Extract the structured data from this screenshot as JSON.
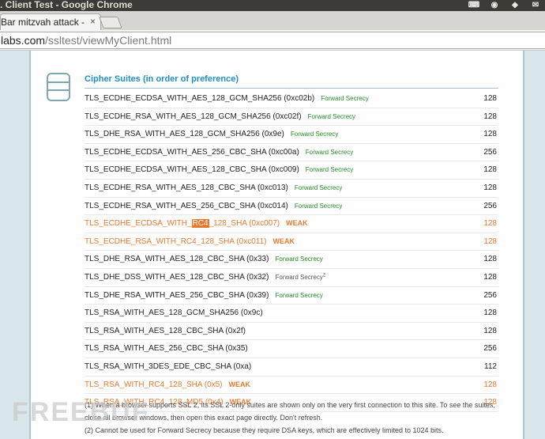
{
  "window": {
    "title": ". Client Test - Google Chrome"
  },
  "tray": {
    "icons": [
      "keyboard-icon",
      "chrome-icon",
      "dropbox-icon",
      "mail-icon"
    ]
  },
  "tab": {
    "label": "Bar mitzvah attack -",
    "close": "×"
  },
  "address": {
    "host": "labs.com",
    "path": "/ssltest/viewMyClient.html"
  },
  "section": {
    "title": "Cipher Suites (in order of preference)"
  },
  "suites": [
    {
      "name": "TLS_ECDHE_ECDSA_WITH_AES_128_GCM_SHA256 (0xc02b)",
      "badge": "Forward Secrecy",
      "bits": "128"
    },
    {
      "name": "TLS_ECDHE_RSA_WITH_AES_128_GCM_SHA256 (0xc02f)",
      "badge": "Forward Secrecy",
      "bits": "128"
    },
    {
      "name": "TLS_DHE_RSA_WITH_AES_128_GCM_SHA256 (0x9e)",
      "badge": "Forward Secrecy",
      "bits": "128"
    },
    {
      "name": "TLS_ECDHE_ECDSA_WITH_AES_256_CBC_SHA (0xc00a)",
      "badge": "Forward Secrecy",
      "bits": "256"
    },
    {
      "name": "TLS_ECDHE_ECDSA_WITH_AES_128_CBC_SHA (0xc009)",
      "badge": "Forward Secrecy",
      "bits": "128"
    },
    {
      "name": "TLS_ECDHE_RSA_WITH_AES_128_CBC_SHA (0xc013)",
      "badge": "Forward Secrecy",
      "bits": "128"
    },
    {
      "name": "TLS_ECDHE_RSA_WITH_AES_256_CBC_SHA (0xc014)",
      "badge": "Forward Secrecy",
      "bits": "256"
    },
    {
      "name_pre": "TLS_ECDHE_ECDSA_WITH_",
      "name_hl": "RC4",
      "name_post": "_128_SHA (0xc007)",
      "weak_label": "WEAK",
      "bits": "128"
    },
    {
      "name": "TLS_ECDHE_RSA_WITH_RC4_128_SHA (0xc011)",
      "weak_label": "WEAK",
      "bits": "128"
    },
    {
      "name": "TLS_DHE_RSA_WITH_AES_128_CBC_SHA (0x33)",
      "badge": "Forward Secrecy",
      "bits": "128"
    },
    {
      "name": "TLS_DHE_DSS_WITH_AES_128_CBC_SHA (0x32)",
      "badge": "Forward Secrecy",
      "sup": "2",
      "bits": "128"
    },
    {
      "name": "TLS_DHE_RSA_WITH_AES_256_CBC_SHA (0x39)",
      "badge": "Forward Secrecy",
      "bits": "256"
    },
    {
      "name": "TLS_RSA_WITH_AES_128_GCM_SHA256 (0x9c)",
      "bits": "128"
    },
    {
      "name": "TLS_RSA_WITH_AES_128_CBC_SHA (0x2f)",
      "bits": "128"
    },
    {
      "name": "TLS_RSA_WITH_AES_256_CBC_SHA (0x35)",
      "bits": "256"
    },
    {
      "name": "TLS_RSA_WITH_3DES_EDE_CBC_SHA (0xa)",
      "bits": "112"
    },
    {
      "name": "TLS_RSA_WITH_RC4_128_SHA (0x5)",
      "weak_label": "WEAK",
      "bits": "128"
    },
    {
      "name": "TLS_RSA_WITH_RC4_128_MD5 (0x4)",
      "weak_label": "WEAK",
      "bits": "128"
    }
  ],
  "notes": {
    "n1": "(1) When a browser supports SSL 2, its SSL 2-only suites are shown only on the very first connection to this site. To see the suites, close all browser windows, then open this exact page directly. Don't refresh.",
    "n2": "(2) Cannot be used for Forward Secrecy because they require DSA keys, which are effectively limited to 1024 bits."
  },
  "watermark": "FREEBUF",
  "colors": {
    "weak": "#e8782e",
    "forward_secrecy": "#238b23",
    "heading": "#1f8fc8"
  }
}
